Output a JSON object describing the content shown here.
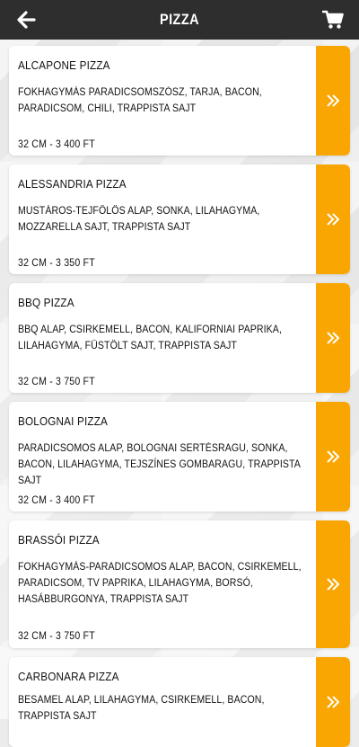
{
  "header": {
    "title": "PIZZA",
    "back_icon": "arrow-left-icon",
    "cart_icon": "shopping-cart-icon"
  },
  "colors": {
    "header_bg": "#2e2e2e",
    "accent": "#f9a602",
    "card_bg": "#ffffff"
  },
  "pizzas": [
    {
      "name": "ALCAPONE PIZZA",
      "description": "FOKHAGYMÁS PARADICSOMSZÓSZ, TARJA, BACON, PARADICSOM, CHILI, TRAPPISTA SAJT",
      "price": "32 CM - 3 400 FT"
    },
    {
      "name": "ALESSANDRIA PIZZA",
      "description": "MUSTÁROS-TEJFÖLÖS ALAP, SONKA, LILAHAGYMA, MOZZARELLA SAJT, TRAPPISTA SAJT",
      "price": "32 CM - 3 350 FT"
    },
    {
      "name": "BBQ PIZZA",
      "description": "BBQ ALAP, CSIRKEMELL, BACON, KALIFORNIAI PAPRIKA, LILAHAGYMA, FÜSTÖLT SAJT, TRAPPISTA SAJT",
      "price": "32 CM - 3 750 FT"
    },
    {
      "name": "BOLOGNAI PIZZA",
      "description": "PARADICSOMOS ALAP, BOLOGNAI SERTÉSRAGU, SONKA, BACON, LILAHAGYMA, TEJSZÍNES GOMBARAGU, TRAPPISTA SAJT",
      "price": "32 CM - 3 400 FT"
    },
    {
      "name": "BRASSÓI PIZZA",
      "description": "FOKHAGYMÁS-PARADICSOMOS ALAP, BACON, CSIRKEMELL, PARADICSOM, TV PAPRIKA, LILAHAGYMA, BORSÓ, HASÁBBURGONYA, TRAPPISTA SAJT",
      "price": "32 CM - 3 750 FT"
    },
    {
      "name": "CARBONARA PIZZA",
      "description": "BESAMEL ALAP, LILAHAGYMA, CSIRKEMELL, BACON, TRAPPISTA SAJT",
      "price": ""
    }
  ]
}
